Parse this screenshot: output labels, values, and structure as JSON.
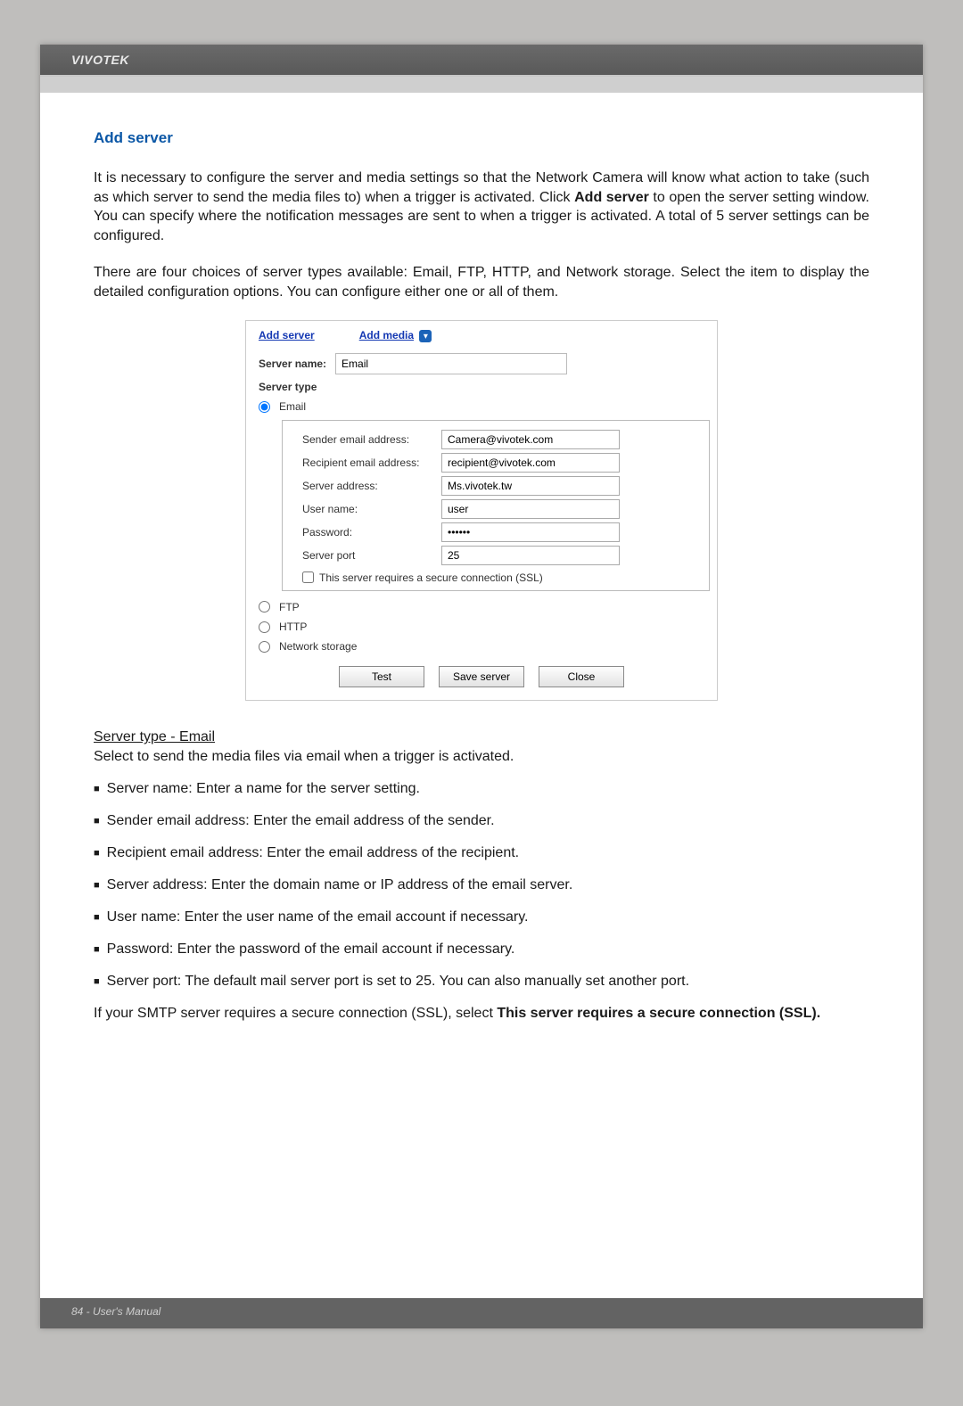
{
  "brand": "VIVOTEK",
  "heading": "Add server",
  "intro_p1a": "It is necessary to configure the server and media settings so that the Network Camera will know what action to take (such as which server to send the media files to) when a trigger is activated. Click ",
  "intro_bold": "Add server",
  "intro_p1b": " to open the server setting window. You can specify where the notification messages are sent to when a trigger is activated. A total of 5 server settings can be configured.",
  "intro_p2": "There are four choices of server types available: Email, FTP, HTTP, and Network storage. Select the item to display the detailed configuration options. You can configure either one or all of them.",
  "shot": {
    "link_add_server": "Add server",
    "link_add_media": "Add media",
    "server_name_label": "Server name:",
    "server_name_value": "Email",
    "server_type_label": "Server type",
    "radio_email": "Email",
    "radio_ftp": "FTP",
    "radio_http": "HTTP",
    "radio_netstorage": "Network storage",
    "fields": {
      "sender_label": "Sender email address:",
      "sender_value": "Camera@vivotek.com",
      "recipient_label": "Recipient email address:",
      "recipient_value": "recipient@vivotek.com",
      "servaddr_label": "Server address:",
      "servaddr_value": "Ms.vivotek.tw",
      "username_label": "User name:",
      "username_value": "user",
      "password_label": "Password:",
      "password_value": "••••••",
      "port_label": "Server port",
      "port_value": "25",
      "ssl_label": "This server requires a secure connection (SSL)"
    },
    "btn_test": "Test",
    "btn_save": "Save server",
    "btn_close": "Close"
  },
  "section_email_heading": "Server type - Email",
  "section_email_sub": "Select to send the media files via email when a trigger is activated.",
  "bullets": {
    "b1": "Server name: Enter a name for the server setting.",
    "b2": "Sender email address: Enter the email address of the sender.",
    "b3": "Recipient email address: Enter the email address of the recipient.",
    "b4": "Server address: Enter the domain name or IP address of the email server.",
    "b5": "User name: Enter the user name of the email account if necessary.",
    "b6": "Password: Enter the password of the email account if necessary.",
    "b7": "Server port: The default mail server port is set to 25. You can also manually set another port."
  },
  "ssl_p_a": "If your SMTP server requires a secure connection (SSL), select ",
  "ssl_p_bold": "This server requires a secure connection (SSL).",
  "footer": "84 - User's Manual"
}
